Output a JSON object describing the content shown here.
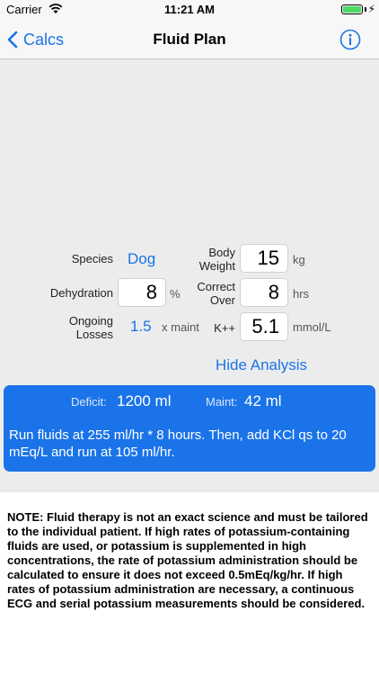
{
  "status_bar": {
    "carrier": "Carrier",
    "time": "11:21 AM"
  },
  "nav": {
    "back_label": "Calcs",
    "title": "Fluid Plan",
    "info_icon": "info-icon"
  },
  "form": {
    "species_label": "Species",
    "species_value": "Dog",
    "body_weight_label": "Body Weight",
    "body_weight_value": "15",
    "body_weight_unit": "kg",
    "dehydration_label": "Dehydration",
    "dehydration_value": "8",
    "dehydration_unit": "%",
    "correct_over_label": "Correct Over",
    "correct_over_value": "8",
    "correct_over_unit": "hrs",
    "ongoing_losses_label": "Ongoing Losses",
    "ongoing_losses_value": "1.5",
    "ongoing_losses_unit": "x maint",
    "potassium_label": "K++",
    "potassium_value": "5.1",
    "potassium_unit": "mmol/L"
  },
  "hide_analysis_label": "Hide Analysis",
  "analysis": {
    "deficit_label": "Deficit:",
    "deficit_value": "1200 ml",
    "maint_label": "Maint:",
    "maint_value": "42 ml",
    "plan_text": "Run fluids at 255 ml/hr * 8 hours. Then, add KCl qs to 20 mEq/L and run at 105 ml/hr."
  },
  "note": "NOTE: Fluid therapy is not an exact science and must be tailored to the individual patient. If high rates of potassium-containing fluids are used, or potassium is supplemented in high concentrations, the rate of potassium administration should be calculated to ensure it does not exceed 0.5mEq/kg/hr. If high rates of potassium administration are necessary, a continuous ECG and serial potassium measurements should be considered.",
  "colors": {
    "accent": "#1a73e8",
    "background": "#ececec",
    "battery": "#4cd964"
  }
}
